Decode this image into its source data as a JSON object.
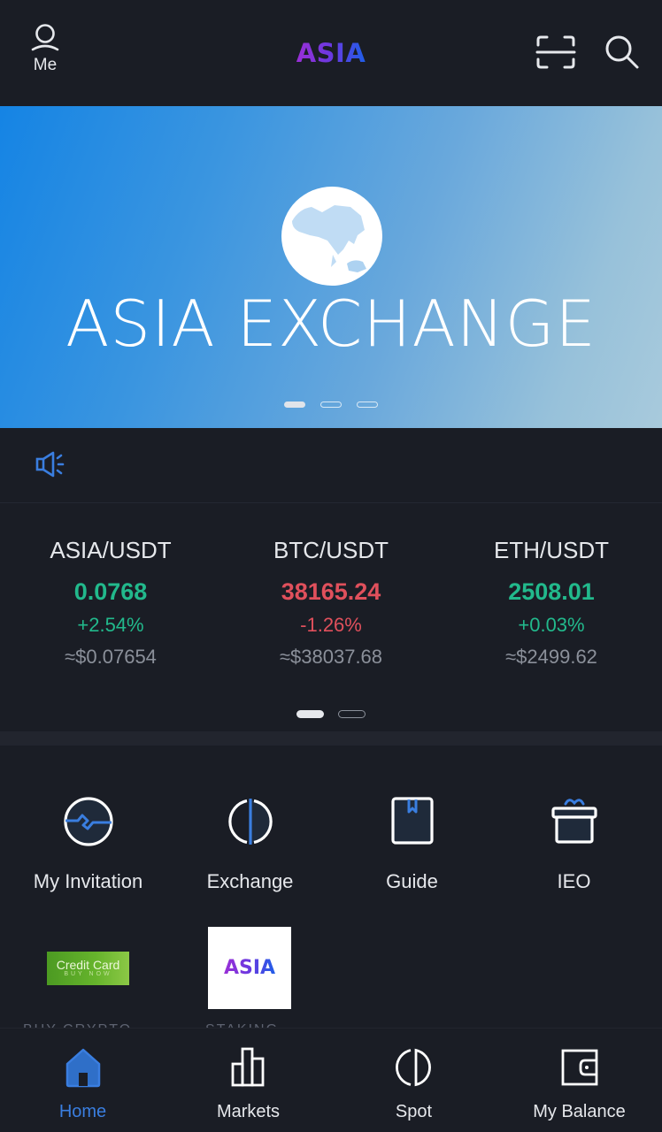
{
  "header": {
    "me_label": "Me",
    "logo_text": "ASIA",
    "icons": {
      "profile": "user-icon",
      "scan": "scan-icon",
      "search": "search-icon"
    }
  },
  "banner": {
    "title": "ASIA EXCHANGE",
    "image": "globe-icon",
    "slides": 3,
    "active_slide": 1
  },
  "notice": {
    "icon": "speaker-icon",
    "text": ""
  },
  "tickers": {
    "items": [
      {
        "pair": "ASIA/USDT",
        "price": "0.0768",
        "change": "+2.54%",
        "usd": "≈$0.07654",
        "direction": "up"
      },
      {
        "pair": "BTC/USDT",
        "price": "38165.24",
        "change": "-1.26%",
        "usd": "≈$38037.68",
        "direction": "down"
      },
      {
        "pair": "ETH/USDT",
        "price": "2508.01",
        "change": "+0.03%",
        "usd": "≈$2499.62",
        "direction": "up"
      }
    ],
    "pages": 2,
    "active_page": 1
  },
  "quick_menu": {
    "items": [
      {
        "label": "My Invitation",
        "icon": "invitation-pulse-icon"
      },
      {
        "label": "Exchange",
        "icon": "exchange-icon"
      },
      {
        "label": "Guide",
        "icon": "guide-book-icon"
      },
      {
        "label": "IEO",
        "icon": "gift-icon"
      }
    ],
    "promo": [
      {
        "image_title": "Credit Card",
        "image_sub": "BUY NOW",
        "label": "BUY CRYPTO"
      },
      {
        "image_title": "ASIA",
        "label": "STAKING"
      }
    ]
  },
  "tabbar": {
    "items": [
      {
        "label": "Home",
        "icon": "home-icon",
        "active": true
      },
      {
        "label": "Markets",
        "icon": "markets-bar-icon",
        "active": false
      },
      {
        "label": "Spot",
        "icon": "spot-icon",
        "active": false
      },
      {
        "label": "My Balance",
        "icon": "wallet-icon",
        "active": false
      }
    ]
  },
  "colors": {
    "background": "#1a1d25",
    "accent": "#3a7ee0",
    "up": "#22b98c",
    "down": "#e0505c",
    "muted": "#8b909a"
  }
}
